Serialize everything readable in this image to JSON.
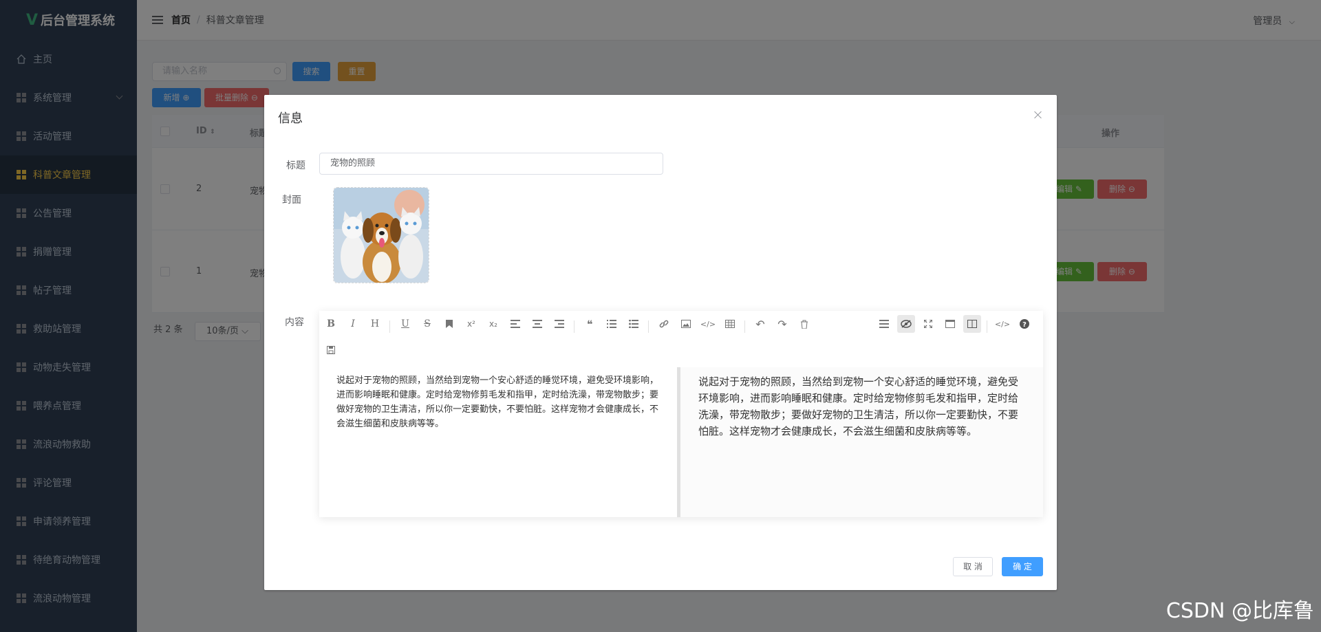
{
  "app": {
    "title": "后台管理系统"
  },
  "sidebar": {
    "items": [
      {
        "label": "主页"
      },
      {
        "label": "系统管理"
      },
      {
        "label": "活动管理"
      },
      {
        "label": "科普文章管理"
      },
      {
        "label": "公告管理"
      },
      {
        "label": "捐赠管理"
      },
      {
        "label": "帖子管理"
      },
      {
        "label": "救助站管理"
      },
      {
        "label": "动物走失管理"
      },
      {
        "label": "喂养点管理"
      },
      {
        "label": "流浪动物救助"
      },
      {
        "label": "评论管理"
      },
      {
        "label": "申请领养管理"
      },
      {
        "label": "待绝育动物管理"
      },
      {
        "label": "流浪动物管理"
      }
    ],
    "active_index": 3
  },
  "header": {
    "breadcrumb_home": "首页",
    "breadcrumb_sep": "/",
    "breadcrumb_current": "科普文章管理",
    "user": "管理员"
  },
  "search": {
    "placeholder": "请输入名称",
    "search_label": "搜索",
    "reset_label": "重置"
  },
  "actions": {
    "add_label": "新增",
    "batch_delete_label": "批量删除"
  },
  "table": {
    "headers": {
      "id": "ID",
      "title": "标题",
      "ops": "操作"
    },
    "rows": [
      {
        "id": "2",
        "title": "宠物",
        "edit": "编辑",
        "delete": "删除"
      },
      {
        "id": "1",
        "title": "宠物",
        "edit": "编辑",
        "delete": "删除"
      }
    ]
  },
  "pagination": {
    "total": "共 2 条",
    "page_size": "10条/页"
  },
  "dialog": {
    "title": "信息",
    "title_label": "标题",
    "title_value": "宠物的照顾",
    "cover_label": "封面",
    "content_label": "内容",
    "content_text": "说起对于宠物的照顾，当然给到宠物一个安心舒适的睡觉环境，避免受环境影响，进而影响睡眠和健康。定时给宠物修剪毛发和指甲，定时给洗澡，带宠物散步；要做好宠物的卫生清洁，所以你一定要勤快，不要怕脏。这样宠物才会健康成长，不会滋生细菌和皮肤病等等。",
    "cancel_label": "取 消",
    "ok_label": "确 定"
  },
  "toolbar": {
    "bold": "B",
    "italic": "I",
    "header": "H",
    "underline": "U",
    "strike": "S",
    "sup": "x²",
    "sub": "x₂",
    "quote": "❝",
    "code": "</>"
  },
  "watermark": "CSDN @比库鲁"
}
